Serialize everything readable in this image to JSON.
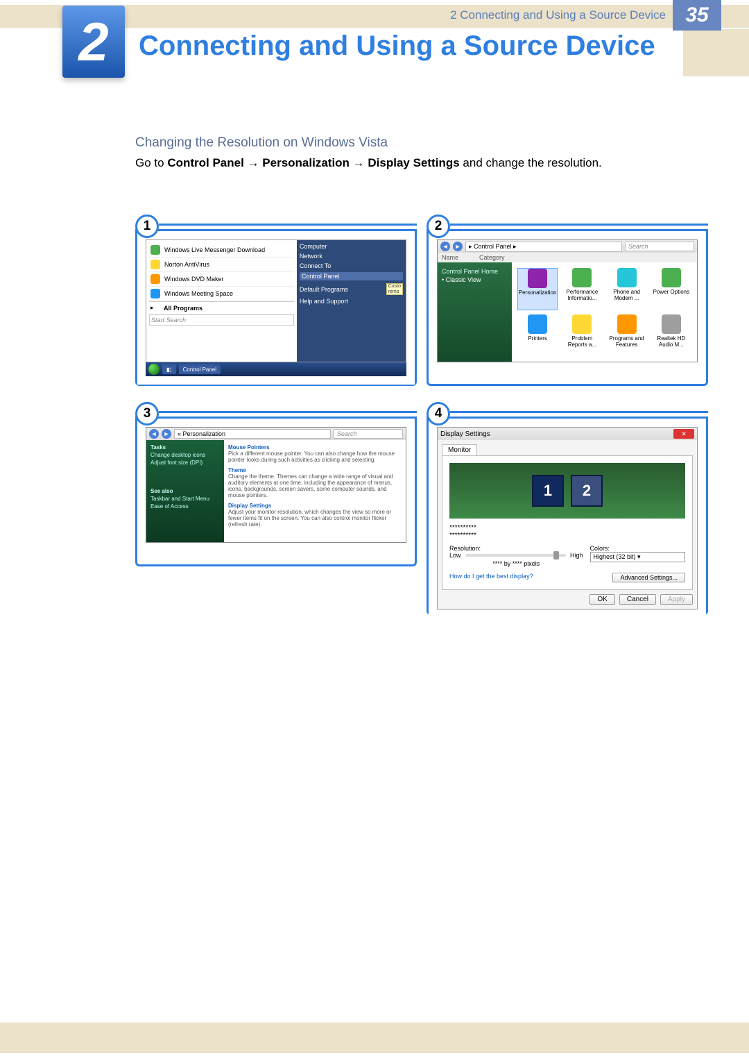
{
  "chapter": {
    "number": "2",
    "title": "Connecting and Using a Source Device"
  },
  "subheading": "Changing the Resolution on Windows Vista",
  "para_pre": "Go to ",
  "para_b1": "Control Panel",
  "para_arr1": " → ",
  "para_b2": "Personalization",
  "para_arr2": " → ",
  "para_b3": "Display Settings",
  "para_post": " and change the resolution.",
  "steps": {
    "s1": "1",
    "s2": "2",
    "s3": "3",
    "s4": "4"
  },
  "startmenu": {
    "left": [
      {
        "label": "Windows Live Messenger Download"
      },
      {
        "label": "Norton AntiVirus"
      },
      {
        "label": "Windows DVD Maker"
      },
      {
        "label": "Windows Meeting Space"
      },
      {
        "label": "All Programs"
      }
    ],
    "right": [
      "Computer",
      "Network",
      "Connect To",
      "Control Panel",
      "Default Programs",
      "Help and Support"
    ],
    "right_hl_index": 3,
    "search_placeholder": "Start Search",
    "taskbar_btn": "Control Panel",
    "custo": "Custo",
    "remo": "remo"
  },
  "controlpanel": {
    "nav": "▸ Control Panel ▸",
    "search": "Search",
    "col_name": "Name",
    "col_cat": "Category",
    "side": [
      "Control Panel Home",
      "Classic View"
    ],
    "items": [
      {
        "label": "Personalization",
        "color": "i-pu",
        "hl": true
      },
      {
        "label": "Performance Informatio...",
        "color": "i-gr"
      },
      {
        "label": "Phone and Modem ...",
        "color": "i-cy"
      },
      {
        "label": "Power Options",
        "color": "i-gr"
      },
      {
        "label": "Printers",
        "color": "i-bl"
      },
      {
        "label": "Problem Reports a...",
        "color": "i-yl"
      },
      {
        "label": "Programs and Features",
        "color": "i-or"
      },
      {
        "label": "Realtek HD Audio M...",
        "color": "i-gy"
      }
    ]
  },
  "personalization": {
    "breadcrumb": "« Personalization",
    "search": "Search",
    "side_tasks": "Tasks",
    "side_links": [
      "Change desktop icons",
      "Adjust font size (DPI)"
    ],
    "side_seealso": "See also",
    "side_seealso_links": [
      "Taskbar and Start Menu",
      "Ease of Access"
    ],
    "items": [
      {
        "title": "Mouse Pointers",
        "desc": "Pick a different mouse pointer. You can also change how the mouse pointer looks during such activities as clicking and selecting."
      },
      {
        "title": "Theme",
        "desc": "Change the theme. Themes can change a wide range of visual and auditory elements at one time, including the appearance of menus, icons, backgrounds, screen savers, some computer sounds, and mouse pointers."
      },
      {
        "title": "Display Settings",
        "desc": "Adjust your monitor resolution, which changes the view so more or fewer items fit on the screen. You can also control monitor flicker (refresh rate)."
      }
    ]
  },
  "display": {
    "title": "Display Settings",
    "tab": "Monitor",
    "mon1": "1",
    "mon2": "2",
    "id1": "**********",
    "id2": "**********",
    "res": "Resolution:",
    "low": "Low",
    "high": "High",
    "pixels": "**** by **** pixels",
    "colors": "Colors:",
    "colorsel": "Highest (32 bit)",
    "help": "How do I get the best display?",
    "adv": "Advanced Settings...",
    "ok": "OK",
    "cancel": "Cancel",
    "apply": "Apply"
  },
  "footer": {
    "text": "2 Connecting and Using a Source Device",
    "page": "35"
  }
}
